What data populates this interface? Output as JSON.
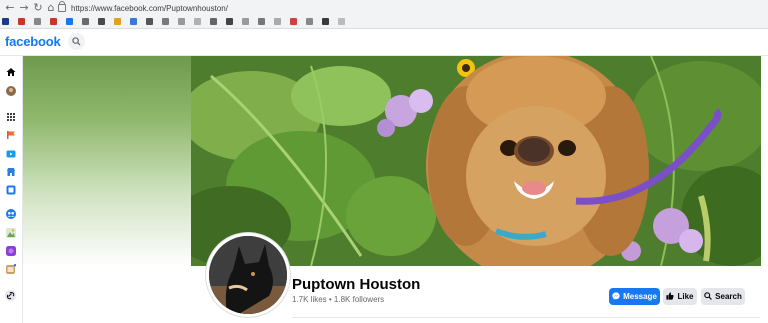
{
  "browser": {
    "url": "https://www.facebook.com/Puptownhouston/",
    "bookmark_colors": [
      "#1a3b8b",
      "#c9372c",
      "#888888",
      "#c9372c",
      "#1877f2",
      "#6b6b6b",
      "#4a4a4a",
      "#e0a020",
      "#3c78d8",
      "#555555",
      "#7a7a7a",
      "#999999",
      "#b0b0b0",
      "#666666",
      "#444444",
      "#9a9a9a",
      "#777777",
      "#aaaaaa",
      "#d04040",
      "#888888",
      "#3a3a3a",
      "#bbbbbb"
    ]
  },
  "header": {
    "logo": "facebook"
  },
  "page": {
    "name": "Puptown Houston",
    "stats": "1.7K likes • 1.8K followers"
  },
  "actions": {
    "message_label": "Message",
    "like_label": "Like",
    "search_label": "Search"
  },
  "colors": {
    "brand": "#1877f2",
    "button_grey": "#e4e6eb"
  }
}
